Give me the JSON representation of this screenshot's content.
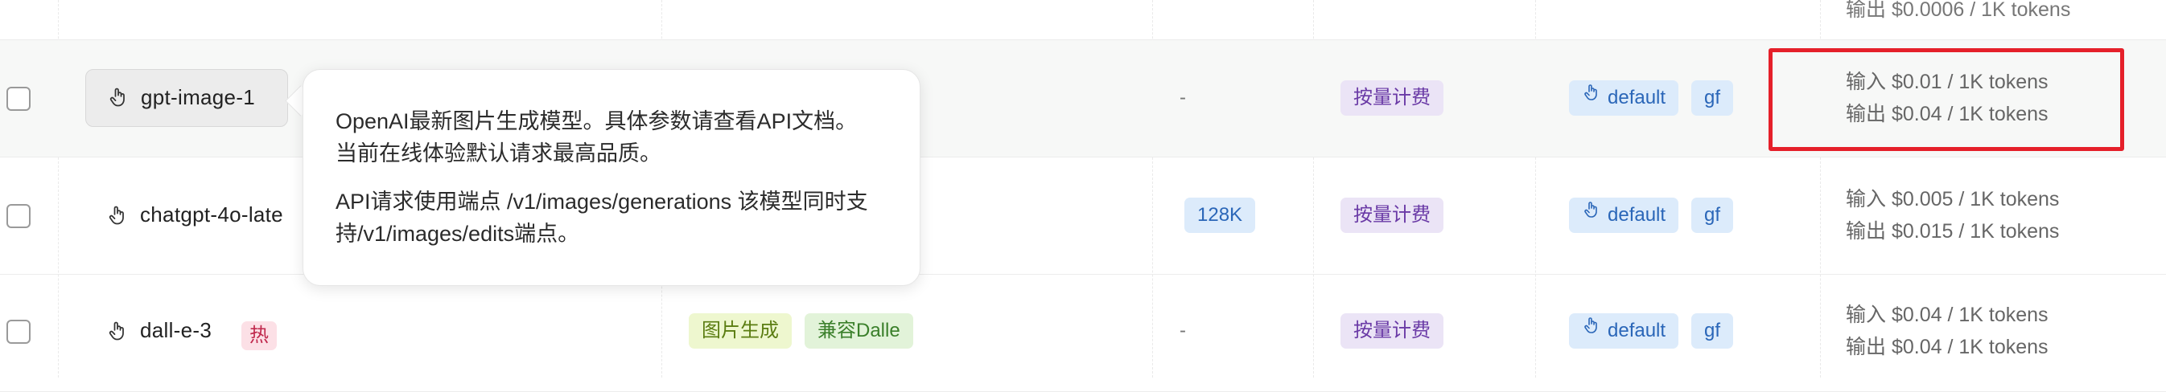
{
  "partial_top": {
    "price_output": "输出 $0.0006 / 1K tokens"
  },
  "rows": [
    {
      "name": "gpt-image-1",
      "context": "-",
      "billing": "按量计费",
      "groups": [
        "default",
        "gf"
      ],
      "price_input": "输入 $0.01 / 1K tokens",
      "price_output": "输出 $0.04 / 1K tokens"
    },
    {
      "name": "chatgpt-4o-late",
      "context": "128K",
      "billing": "按量计费",
      "groups": [
        "default",
        "gf"
      ],
      "price_input": "输入 $0.005 / 1K tokens",
      "price_output": "输出 $0.015 / 1K tokens"
    },
    {
      "name": "dall-e-3",
      "hot_badge": "热",
      "tags": [
        "图片生成",
        "兼容Dalle"
      ],
      "context": "-",
      "billing": "按量计费",
      "groups": [
        "default",
        "gf"
      ],
      "price_input": "输入 $0.04 / 1K tokens",
      "price_output": "输出 $0.04 / 1K tokens"
    }
  ],
  "tooltip": {
    "line1": "OpenAI最新图片生成模型。具体参数请查看API文档。",
    "line2": "当前在线体验默认请求最高品质。",
    "line3": "API请求使用端点 /v1/images/generations 该模型同时支",
    "line4": "持/v1/images/edits端点。"
  },
  "colors": {
    "highlight_box": "#e5202a",
    "billing_tag_bg": "#ebe4f6",
    "group_tag_bg": "#dcebfb"
  }
}
